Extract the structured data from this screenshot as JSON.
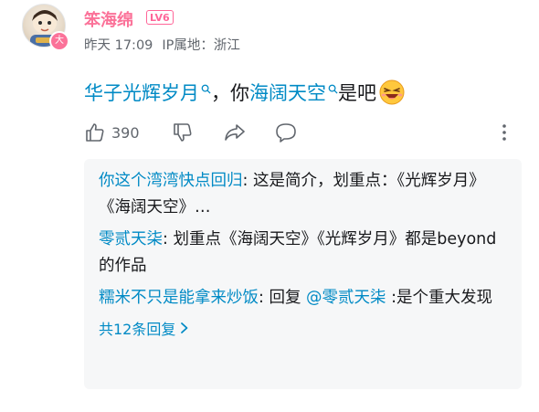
{
  "comment": {
    "user": {
      "name": "笨海绵",
      "level": "LV6",
      "avatar_badge": "大"
    },
    "time": "昨天 17:09",
    "ip_location": "IP属地：浙江",
    "text": {
      "link1": "华子光辉岁月",
      "sep": "，你",
      "link2": "海阔天空",
      "tail": "是吧"
    },
    "likes": "390"
  },
  "replies": [
    {
      "name": "你这个湾湾快点回归",
      "text": ": 这是简介，划重点：《光辉岁月》《海阔天空》…"
    },
    {
      "name": "零贰天柒",
      "text": ": 划重点《海阔天空》《光辉岁月》都是beyond的作品"
    },
    {
      "name": "糯米不只是能拿来炒饭",
      "text": ": 回复 ",
      "mention": "@零贰天柒",
      "tail": " :是个重大发现"
    }
  ],
  "more_replies": "共12条回复",
  "colors": {
    "username": "#fb7299",
    "link": "#008ac5",
    "meta": "#61666d",
    "reply_bg": "#f6f7f8"
  },
  "icons": [
    "thumb-up-icon",
    "thumb-down-icon",
    "share-icon",
    "comment-icon",
    "more-icon",
    "search-icon",
    "chevron-right-icon",
    "laughing-emoji-icon"
  ]
}
